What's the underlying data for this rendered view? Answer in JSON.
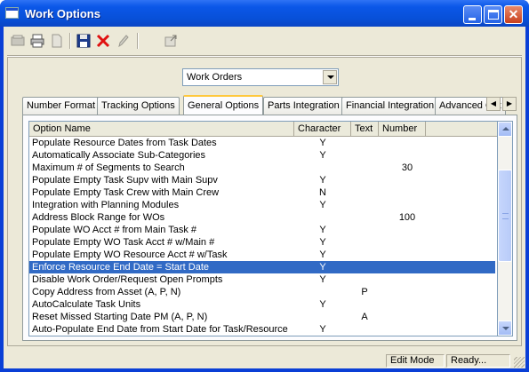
{
  "window": {
    "title": "Work Options",
    "controls": {
      "minimize": "",
      "maximize": "",
      "close": "✕"
    }
  },
  "toolbar": {
    "icons": [
      "new-icon",
      "print-icon",
      "page-icon",
      "save-icon",
      "delete-icon",
      "edit-icon",
      "export-icon"
    ]
  },
  "selector": {
    "value": "Work Orders"
  },
  "tabs": [
    {
      "label": "Number Format"
    },
    {
      "label": "Tracking Options"
    },
    {
      "label": "General Options",
      "active": true
    },
    {
      "label": "Parts Integration"
    },
    {
      "label": "Financial Integration"
    },
    {
      "label": "Advanced Opt"
    }
  ],
  "grid": {
    "columns": [
      "Option Name",
      "Character",
      "Text",
      "Number"
    ],
    "rows": [
      [
        "Populate Resource Dates from Task Dates",
        "Y",
        "",
        ""
      ],
      [
        "Automatically Associate Sub-Categories",
        "Y",
        "",
        ""
      ],
      [
        "Maximum # of Segments to Search",
        "",
        "",
        "30"
      ],
      [
        "Populate Empty Task Supv with Main Supv",
        "Y",
        "",
        ""
      ],
      [
        "Populate Empty Task Crew with Main Crew",
        "N",
        "",
        ""
      ],
      [
        "Integration with Planning Modules",
        "Y",
        "",
        ""
      ],
      [
        "Address Block Range for WOs",
        "",
        "",
        "100"
      ],
      [
        "Populate WO Acct # from Main Task #",
        "Y",
        "",
        ""
      ],
      [
        "Populate Empty WO Task Acct # w/Main #",
        "Y",
        "",
        ""
      ],
      [
        "Populate Empty WO Resource Acct # w/Task",
        "Y",
        "",
        ""
      ],
      [
        "Enforce Resource End Date = Start Date",
        "Y",
        "",
        ""
      ],
      [
        "Disable Work Order/Request Open Prompts",
        "Y",
        "",
        ""
      ],
      [
        "Copy Address from Asset (A, P, N)",
        "",
        "P",
        ""
      ],
      [
        "AutoCalculate Task Units",
        "Y",
        "",
        ""
      ],
      [
        "Reset Missed Starting Date PM (A, P, N)",
        "",
        "A",
        ""
      ],
      [
        "Auto-Populate End Date from Start Date for Task/Resource",
        "Y",
        "",
        ""
      ]
    ],
    "selected_row": "Enforce Resource End Date = Start Date"
  },
  "status": {
    "mode": "Edit Mode",
    "message": "Ready..."
  },
  "colors": {
    "title": "#0b57e8",
    "selection": "#316ac5",
    "face": "#ece9d8",
    "active_tab_accent": "#ffc83c"
  }
}
